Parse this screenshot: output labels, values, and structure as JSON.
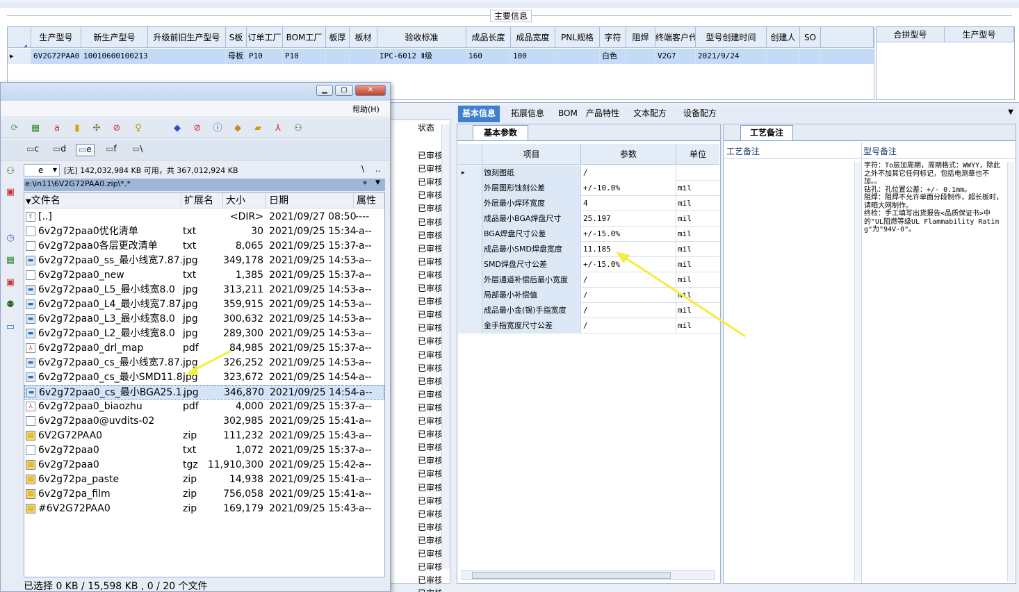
{
  "main_info": {
    "legend": "主要信息",
    "columns": [
      "生产型号",
      "新生产型号",
      "升级前旧生产型号",
      "S板",
      "订单工厂",
      "BOM工厂",
      "板厚",
      "板材",
      "验收标准",
      "成品长度",
      "成品宽度",
      "PNL规格",
      "字符",
      "阻焊",
      "终端客户代码",
      "型号创建时间",
      "创建人",
      "SO"
    ],
    "row": [
      "6V2G72PAA0",
      "10010600100213",
      "",
      "母板",
      "P10",
      "P10",
      "",
      "",
      "IPC-6012 Ⅱ级",
      "160",
      "100",
      "",
      "白色",
      "",
      "V2G7",
      "2021/9/24",
      "",
      ""
    ],
    "side_columns": [
      "合拼型号",
      "生产型号"
    ]
  },
  "tabs": [
    "基本信息",
    "拓展信息",
    "BOM",
    "产品特性",
    "文本配方",
    "设备配方"
  ],
  "active_tab": "基本信息",
  "basic_params": {
    "title": "基本参数",
    "headers": [
      "项目",
      "参数",
      "单位"
    ],
    "rows": [
      {
        "item": "蚀刻图纸",
        "value": "/",
        "unit": ""
      },
      {
        "item": "外层图形蚀刻公差",
        "value": "+/-10.0%",
        "unit": "mil"
      },
      {
        "item": "外层最小焊环宽度",
        "value": "4",
        "unit": "mil"
      },
      {
        "item": "成品最小BGA焊盘尺寸",
        "value": "25.197",
        "unit": "mil"
      },
      {
        "item": "BGA焊盘尺寸公差",
        "value": "+/-15.0%",
        "unit": "mil"
      },
      {
        "item": "成品最小SMD焊盘宽度",
        "value": "11.185",
        "unit": "mil"
      },
      {
        "item": "SMD焊盘尺寸公差",
        "value": "+/-15.0%",
        "unit": "mil"
      },
      {
        "item": "外层通道补偿后最小宽度",
        "value": "/",
        "unit": "mil"
      },
      {
        "item": "局部最小补偿值",
        "value": "/",
        "unit": "mil"
      },
      {
        "item": "成品最小金(锡)手指宽度",
        "value": "/",
        "unit": "mil"
      },
      {
        "item": "金手指宽度尺寸公差",
        "value": "/",
        "unit": "mil"
      }
    ]
  },
  "process_notes": {
    "title": "工艺备注",
    "col1": "工艺备注",
    "col2": "型号备注",
    "text": "字符：To层加周期，周期格式：WWYY，除此之外不加其它任何标记，包括电测章也不加。。\n钻孔：孔位置公差：+/- 0.1mm。\n阻焊：阻焊不允许单面分段制作，超长板时，请晒大网制作。\n终检：手工填写出货报告<品质保证书>中的\"UL阻燃等级UL Flammability Rating\"为\"94V-0\"。"
  },
  "status_col": {
    "header": "状态",
    "value": "已审核",
    "count": 34
  },
  "file_manager": {
    "menu_help": "帮助(H)",
    "drives": [
      "c",
      "d",
      "e",
      "f",
      "\\"
    ],
    "drive_select": "e",
    "free_space": "[无] 142,032,984 KB 可用，共 367,012,924 KB",
    "path": "e:\\in11\\6V2G72PAA0.zip\\*.*",
    "path_tail": "*",
    "headers": [
      "文件名",
      "扩展名",
      "大小",
      "日期",
      "属性"
    ],
    "files": [
      {
        "name": "[..]",
        "ext": "",
        "size": "<DIR>",
        "date": "2021/09/27 08:50",
        "attr": "----",
        "icon": "up"
      },
      {
        "name": "6v2g72paa0优化清单",
        "ext": "txt",
        "size": "30",
        "date": "2021/09/25 15:34",
        "attr": "-a--",
        "icon": "doc"
      },
      {
        "name": "6v2g72paa0各层更改清单",
        "ext": "txt",
        "size": "8,065",
        "date": "2021/09/25 15:37",
        "attr": "-a--",
        "icon": "doc"
      },
      {
        "name": "6v2g72paa0_ss_最小线宽7.87..",
        "ext": "jpg",
        "size": "349,178",
        "date": "2021/09/25 14:53",
        "attr": "-a--",
        "icon": "img"
      },
      {
        "name": "6v2g72paa0_new",
        "ext": "txt",
        "size": "1,385",
        "date": "2021/09/25 15:37",
        "attr": "-a--",
        "icon": "doc"
      },
      {
        "name": "6v2g72paa0_L5_最小线宽8.0",
        "ext": "jpg",
        "size": "313,211",
        "date": "2021/09/25 14:53",
        "attr": "-a--",
        "icon": "img"
      },
      {
        "name": "6v2g72paa0_L4_最小线宽7.87..",
        "ext": "jpg",
        "size": "359,915",
        "date": "2021/09/25 14:53",
        "attr": "-a--",
        "icon": "img"
      },
      {
        "name": "6v2g72paa0_L3_最小线宽8.0",
        "ext": "jpg",
        "size": "300,632",
        "date": "2021/09/25 14:53",
        "attr": "-a--",
        "icon": "img"
      },
      {
        "name": "6v2g72paa0_L2_最小线宽8.0",
        "ext": "jpg",
        "size": "289,300",
        "date": "2021/09/25 14:53",
        "attr": "-a--",
        "icon": "img"
      },
      {
        "name": "6v2g72paa0_drl_map",
        "ext": "pdf",
        "size": "84,985",
        "date": "2021/09/25 15:37",
        "attr": "-a--",
        "icon": "pdf"
      },
      {
        "name": "6v2g72paa0_cs_最小线宽7.87..",
        "ext": "jpg",
        "size": "326,252",
        "date": "2021/09/25 14:53",
        "attr": "-a--",
        "icon": "img"
      },
      {
        "name": "6v2g72paa0_cs_最小SMD11.8..",
        "ext": "jpg",
        "size": "323,672",
        "date": "2021/09/25 14:54",
        "attr": "-a--",
        "icon": "img"
      },
      {
        "name": "6v2g72paa0_cs_最小BGA25.1..",
        "ext": "jpg",
        "size": "346,870",
        "date": "2021/09/25 14:54",
        "attr": "-a--",
        "icon": "img",
        "selected": true
      },
      {
        "name": "6v2g72paa0_biaozhu",
        "ext": "pdf",
        "size": "4,000",
        "date": "2021/09/25 15:37",
        "attr": "-a--",
        "icon": "pdf"
      },
      {
        "name": "6v2g72paa0@uvdits-02",
        "ext": "",
        "size": "302,985",
        "date": "2021/09/25 15:41",
        "attr": "-a--",
        "icon": "doc"
      },
      {
        "name": "6V2G72PAA0",
        "ext": "zip",
        "size": "111,232",
        "date": "2021/09/25 15:43",
        "attr": "-a--",
        "icon": "zip"
      },
      {
        "name": "6v2g72paa0",
        "ext": "txt",
        "size": "1,072",
        "date": "2021/09/25 15:37",
        "attr": "-a--",
        "icon": "doc"
      },
      {
        "name": "6v2g72paa0",
        "ext": "tgz",
        "size": "11,910,300",
        "date": "2021/09/25 15:42",
        "attr": "-a--",
        "icon": "zip"
      },
      {
        "name": "6v2g72pa_paste",
        "ext": "zip",
        "size": "14,938",
        "date": "2021/09/25 15:41",
        "attr": "-a--",
        "icon": "zip"
      },
      {
        "name": "6v2g72pa_film",
        "ext": "zip",
        "size": "756,058",
        "date": "2021/09/25 15:41",
        "attr": "-a--",
        "icon": "zip"
      },
      {
        "name": "#6V2G72PAA0",
        "ext": "zip",
        "size": "169,179",
        "date": "2021/09/25 15:43",
        "attr": "-a--",
        "icon": "zip"
      }
    ],
    "status": "已选择 0 KB / 15,598 KB , 0 / 20 个文件"
  },
  "colors": {
    "accent": "#3f7fd0",
    "selection": "#c3dbf6",
    "arrow": "#f2ee3c"
  }
}
